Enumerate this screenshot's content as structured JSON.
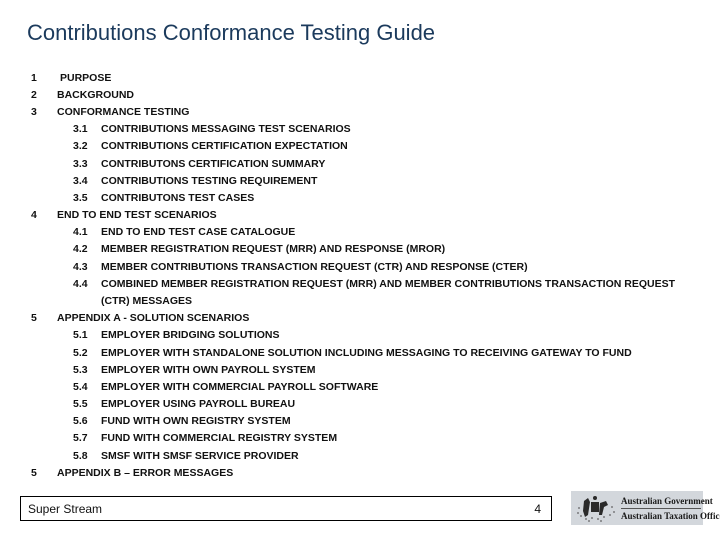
{
  "title": "Contributions Conformance Testing Guide",
  "toc": [
    {
      "num": "1",
      "text": "PURPOSE",
      "level": 1
    },
    {
      "num": "2",
      "text": "BACKGROUND",
      "level": 1
    },
    {
      "num": "3",
      "text": "CONFORMANCE TESTING",
      "level": 1
    },
    {
      "num": "3.1",
      "text": "CONTRIBUTIONS MESSAGING TEST SCENARIOS",
      "level": 2
    },
    {
      "num": "3.2",
      "text": "CONTRIBUTIONS CERTIFICATION EXPECTATION",
      "level": 2
    },
    {
      "num": "3.3",
      "text": "CONTRIBUTONS CERTIFICATION SUMMARY",
      "level": 2
    },
    {
      "num": "3.4",
      "text": "CONTRIBUTIONS TESTING REQUIREMENT",
      "level": 2
    },
    {
      "num": "3.5",
      "text": "CONTRIBUTONS TEST CASES",
      "level": 2
    },
    {
      "num": "4",
      "text": "END TO END TEST SCENARIOS",
      "level": 1
    },
    {
      "num": "4.1",
      "text": "END TO END TEST CASE CATALOGUE",
      "level": 2
    },
    {
      "num": "4.2",
      "text": "MEMBER REGISTRATION REQUEST (MRR) AND RESPONSE (MROR)",
      "level": 2
    },
    {
      "num": "4.3",
      "text": "MEMBER CONTRIBUTIONS TRANSACTION REQUEST (CTR) AND RESPONSE (CTER)",
      "level": 2
    },
    {
      "num": "4.4",
      "text": "COMBINED MEMBER REGISTRATION REQUEST (MRR) AND MEMBER CONTRIBUTIONS TRANSACTION REQUEST",
      "level": 2
    },
    {
      "num": "",
      "text": "(CTR) MESSAGES",
      "level": 2
    },
    {
      "num": "5",
      "text": "APPENDIX A - SOLUTION SCENARIOS",
      "level": 1
    },
    {
      "num": "5.1",
      "text": "EMPLOYER BRIDGING SOLUTIONS",
      "level": 2
    },
    {
      "num": "5.2",
      "text": "EMPLOYER WITH STANDALONE SOLUTION INCLUDING MESSAGING TO RECEIVING GATEWAY TO FUND",
      "level": 2
    },
    {
      "num": "5.3",
      "text": "EMPLOYER WITH OWN PAYROLL SYSTEM",
      "level": 2
    },
    {
      "num": "5.4",
      "text": "EMPLOYER WITH COMMERCIAL PAYROLL SOFTWARE",
      "level": 2
    },
    {
      "num": "5.5",
      "text": "EMPLOYER USING PAYROLL BUREAU",
      "level": 2
    },
    {
      "num": "5.6",
      "text": "FUND WITH OWN REGISTRY SYSTEM",
      "level": 2
    },
    {
      "num": "5.7",
      "text": "FUND WITH COMMERCIAL REGISTRY SYSTEM",
      "level": 2
    },
    {
      "num": "5.8",
      "text": "SMSF WITH SMSF SERVICE PROVIDER",
      "level": 2
    },
    {
      "num": "5",
      "text": "APPENDIX B – ERROR MESSAGES",
      "level": 1
    }
  ],
  "footer": {
    "left": "Super Stream",
    "page": "4"
  },
  "logo": {
    "line1": "Australian Government",
    "line2": "Australian Taxation Office"
  }
}
